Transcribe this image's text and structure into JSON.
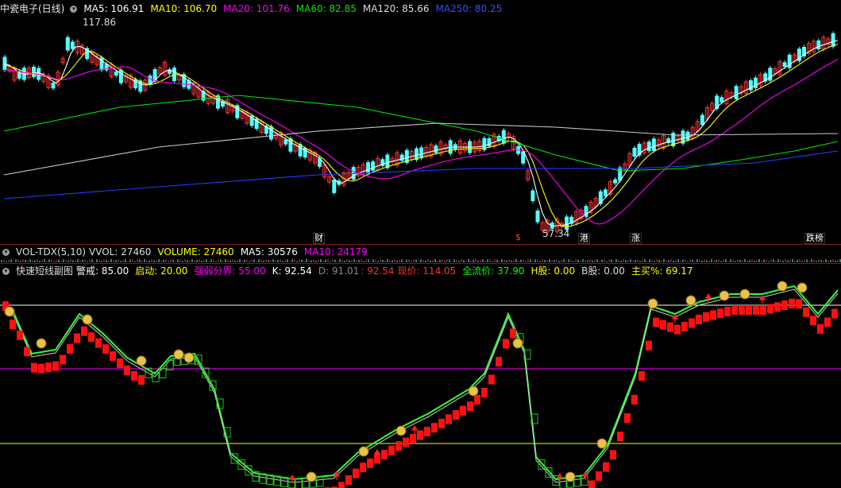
{
  "main_legend": {
    "title": "中瓷电子(日线)",
    "ma5": "MA5: 106.91",
    "ma10": "MA10: 106.70",
    "ma20": "MA20: 101.76",
    "ma60": "MA60: 82.85",
    "ma120": "MA120: 85.66",
    "ma250": "MA250: 80.25"
  },
  "price_labels": {
    "high": "117.86",
    "low": "57.34"
  },
  "event_markers": {
    "cai": "财",
    "s": "$",
    "gang": "港",
    "zhang": "涨",
    "dieting": "跌榜"
  },
  "vol_legend": {
    "title": "VOL-TDX(5,10)",
    "vvol": "VVOL: 27460",
    "volume": "VOLUME: 27460",
    "ma5": "MA5: 30576",
    "ma10": "MA10: 24179"
  },
  "ind_legend": {
    "title": "快速短线副图",
    "jingjie": "警戒: 85.00",
    "qidong": "启动: 20.00",
    "qiangruo": "强弱分界: 55.00",
    "k": "K: 92.54",
    "d": "D: 91.01",
    "j": ": 92.54",
    "xianjia": "现价: 114.05",
    "quanliu": "全流价: 37.90",
    "hgu": "H股: 0.00",
    "bgu": "B股: 0.00",
    "zhumai": "主买%: 69.17"
  },
  "colors": {
    "up": "#ff3232",
    "down": "#54ffff",
    "ma5": "#ffffff",
    "ma10": "#ffff00",
    "ma20": "#ff00ff",
    "ma60": "#00e600",
    "ma120": "#cccccc",
    "ma250": "#2040ff"
  }
}
